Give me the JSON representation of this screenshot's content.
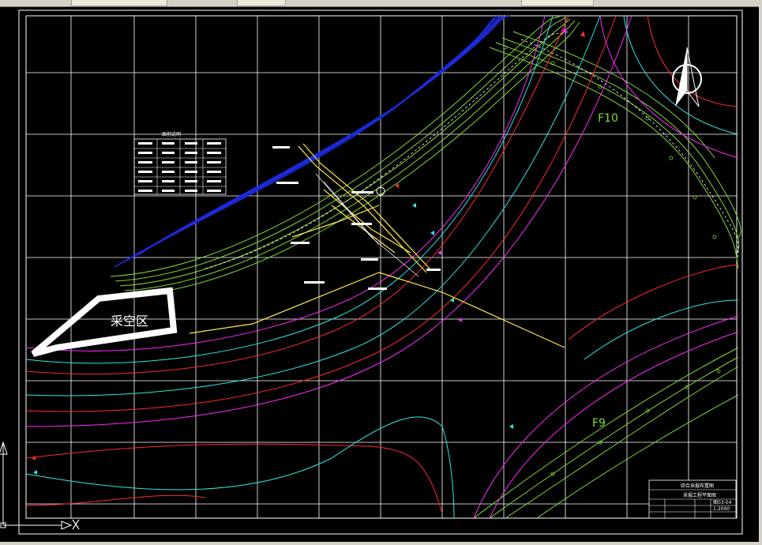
{
  "drawing": {
    "mining_area_label": "采空区",
    "fault_labels": [
      "F10",
      "F9"
    ],
    "north_arrow_icon": "north-arrow-icon",
    "legend": {
      "title": "图例说明",
      "rows": 6
    },
    "title_block": {
      "title": "综合采掘布置图",
      "subtitle": "采掘工程平面图",
      "drawing_number": "图03-04",
      "scale": "1:2000"
    },
    "ucs_icon": "ucs-axis-icon",
    "colors": {
      "background": "#000000",
      "grid": "#ffffff",
      "contour_red": "#ff2a2a",
      "contour_cyan": "#2ee6e6",
      "contour_magenta": "#ff2aff",
      "fault_green": "#7ddc3a",
      "coal_blue": "#1c2bd8",
      "roadway_yellow": "#ffe84a"
    }
  }
}
